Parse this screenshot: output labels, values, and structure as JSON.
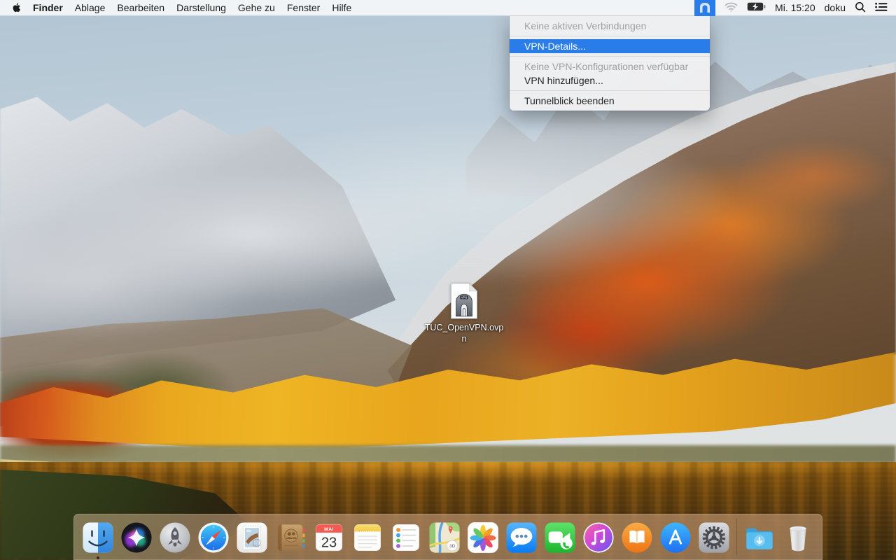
{
  "menu_bar": {
    "apple_icon": "apple-logo",
    "items": [
      {
        "label": "Finder",
        "bold": true
      },
      {
        "label": "Ablage"
      },
      {
        "label": "Bearbeiten"
      },
      {
        "label": "Darstellung"
      },
      {
        "label": "Gehe zu"
      },
      {
        "label": "Fenster"
      },
      {
        "label": "Hilfe"
      }
    ],
    "status": {
      "tunnelblick_icon": "tunnelblick-vpn-icon",
      "wifi_icon": "wifi-icon",
      "battery_icon": "battery-charging-icon",
      "clock": "Mi. 15:20",
      "user": "doku",
      "spotlight_icon": "spotlight-search-icon",
      "notification_icon": "notification-center-icon"
    }
  },
  "tunnelblick_menu": {
    "items": [
      {
        "label": "Keine aktiven Verbindungen",
        "state": "disabled"
      },
      {
        "label": "VPN-Details...",
        "state": "highlighted"
      },
      {
        "label": "Keine VPN-Konfigurationen verfügbar",
        "state": "disabled"
      },
      {
        "label": "VPN hinzufügen...",
        "state": "enabled"
      },
      {
        "label": "Tunnelblick beenden",
        "state": "enabled"
      }
    ],
    "highlight_color": "#2a7de8"
  },
  "desktop": {
    "file_label_line1": "TUC_OpenVPN.ovp",
    "file_label_line2": "n",
    "file_badge": "VPN"
  },
  "dock": {
    "items": [
      "finder",
      "siri",
      "launchpad",
      "safari",
      "mail",
      "contacts",
      "calendar",
      "notes",
      "reminders",
      "maps",
      "photos",
      "messages",
      "facetime",
      "itunes",
      "ibooks",
      "app-store",
      "system-preferences",
      "downloads-folder",
      "trash"
    ],
    "calendar_month": "MAI",
    "calendar_day": "23",
    "maps_badge": "3D"
  },
  "colors": {
    "menu_highlight": "#2a7de8",
    "menu_bar_bg": "#f6f7f8",
    "dock_tint": "rgba(233,196,168,0.45)"
  }
}
